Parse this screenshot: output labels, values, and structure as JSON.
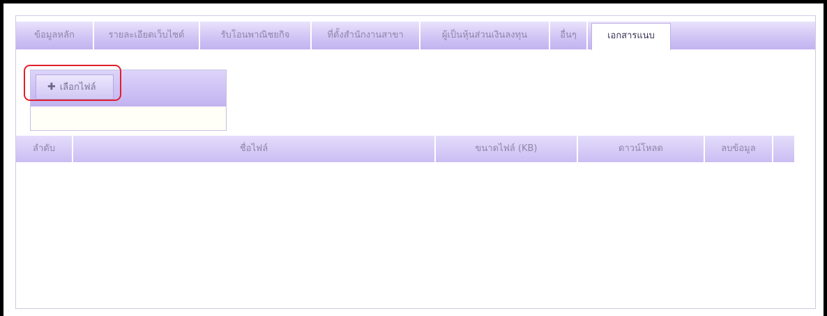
{
  "tabs": [
    {
      "label": "ข้อมูลหลัก",
      "active": false
    },
    {
      "label": "รายละเอียดเว็บไซต์",
      "active": false
    },
    {
      "label": "รับโอนพาณิชยกิจ",
      "active": false
    },
    {
      "label": "ที่ตั้งสำนักงานสาขา",
      "active": false
    },
    {
      "label": "ผู้เป็นหุ้นส่วนเงินลงทุน",
      "active": false
    },
    {
      "label": "อื่นๆ",
      "active": false
    },
    {
      "label": "เอกสารแนบ",
      "active": true
    }
  ],
  "upload": {
    "button_label": "เลือกไฟล์",
    "button_icon": "plus-icon"
  },
  "table": {
    "columns": [
      "ลำดับ",
      "ชื่อไฟล์",
      "ขนาดไฟล์ (KB)",
      "ดาวน์โหลด",
      "ลบข้อมูล"
    ],
    "rows": []
  },
  "colors": {
    "header_gradient_top": "#e9e3fb",
    "header_gradient_bottom": "#c2b3f0",
    "highlight": "#e01f2b"
  }
}
